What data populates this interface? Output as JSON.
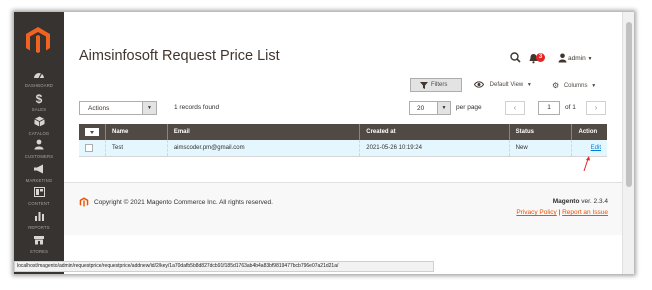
{
  "sidebar": {
    "items": [
      {
        "label": "DASHBOARD",
        "icon": "dashboard-icon"
      },
      {
        "label": "SALES",
        "icon": "dollar-icon"
      },
      {
        "label": "CATALOG",
        "icon": "box-icon"
      },
      {
        "label": "CUSTOMERS",
        "icon": "people-icon"
      },
      {
        "label": "MARKETING",
        "icon": "megaphone-icon"
      },
      {
        "label": "CONTENT",
        "icon": "layout-icon"
      },
      {
        "label": "REPORTS",
        "icon": "bar-chart-icon"
      },
      {
        "label": "STORES",
        "icon": "store-icon"
      }
    ]
  },
  "header": {
    "title": "Aimsinfosoft Request Price List",
    "notification_count": "3",
    "user": "admin"
  },
  "toolbar": {
    "filters_label": "Filters",
    "default_view_label": "Default View",
    "columns_label": "Columns",
    "actions_label": "Actions",
    "records_found": "1 records found",
    "per_page_value": "20",
    "per_page_label": "per page",
    "page_current": "1",
    "page_of": "of 1"
  },
  "grid": {
    "columns": [
      "Name",
      "Email",
      "Created at",
      "Status",
      "Action"
    ],
    "rows": [
      {
        "name": "Test",
        "email": "aimscoder.pm@gmail.com",
        "created_at": "2021-05-26 10:19:24",
        "status": "New",
        "action": "Edit"
      }
    ]
  },
  "footer": {
    "copyright": "Copyright © 2021 Magento Commerce Inc. All rights reserved.",
    "version_brand": "Magento",
    "version_text": "ver. 2.3.4",
    "privacy_policy": "Privacy Policy",
    "separator": "|",
    "report_issue": "Report an Issue"
  },
  "status_bar": {
    "url": "localhost/magento/admin/requestprice/requestprice/addnew/id/2/key/1a70dafb5b8d827dcb91f185d1763ab4b4a83bf9819477bcb796e07a21d21a/"
  },
  "colors": {
    "sidebar_bg": "#373330",
    "header_row": "#514943",
    "accent": "#eb5202",
    "link": "#007bdb",
    "badge": "#e22626",
    "row_bg": "#e5f7fe"
  }
}
